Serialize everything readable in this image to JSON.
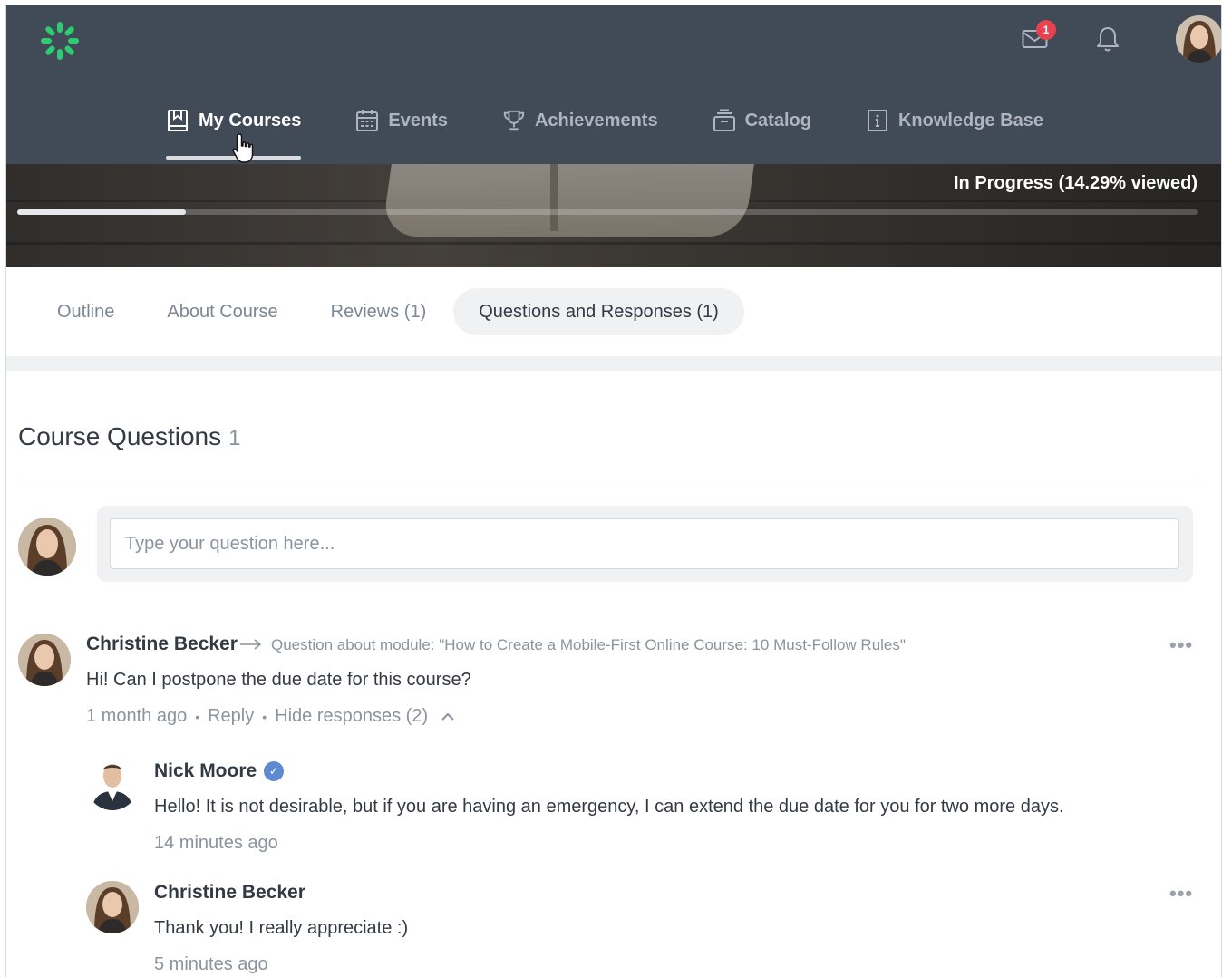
{
  "header": {
    "logo_text": "",
    "mail_badge": "1",
    "colors": {
      "header_bg": "#414b57",
      "badge": "#e8414f",
      "logo_green": "#2ecc71"
    }
  },
  "nav": {
    "items": [
      {
        "label": "My Courses",
        "icon": "book-icon",
        "active": true
      },
      {
        "label": "Events",
        "icon": "calendar-icon",
        "active": false
      },
      {
        "label": "Achievements",
        "icon": "trophy-icon",
        "active": false
      },
      {
        "label": "Catalog",
        "icon": "catalog-icon",
        "active": false
      },
      {
        "label": "Knowledge Base",
        "icon": "info-book-icon",
        "active": false
      }
    ]
  },
  "banner": {
    "progress_text": "In Progress (14.29% viewed)",
    "progress_fraction": 0.1429
  },
  "tabs": [
    {
      "label": "Outline",
      "active": false
    },
    {
      "label": "About Course",
      "active": false
    },
    {
      "label": "Reviews (1)",
      "active": false
    },
    {
      "label": "Questions and Responses (1)",
      "active": true
    }
  ],
  "questions": {
    "title": "Course Questions",
    "count": "1",
    "input_placeholder": "Type your question here...",
    "items": [
      {
        "author": "Christine Becker",
        "module": "Question about module: \"How to Create a Mobile-First Online Course: 10 Must-Follow Rules\"",
        "text": "Hi! Can I postpone the due date for this course?",
        "time": "1 month ago",
        "reply_label": "Reply",
        "hide_label": "Hide responses (2)",
        "more": "•••",
        "responses": [
          {
            "author": "Nick Moore",
            "verified": true,
            "text": "Hello! It is not desirable, but if you are having an emergency,  I can extend the due date for you for two more days.",
            "time": "14 minutes ago"
          },
          {
            "author": "Christine Becker",
            "text": "Thank you! I really appreciate :)",
            "time": "5 minutes ago",
            "more": "•••"
          }
        ]
      }
    ]
  }
}
